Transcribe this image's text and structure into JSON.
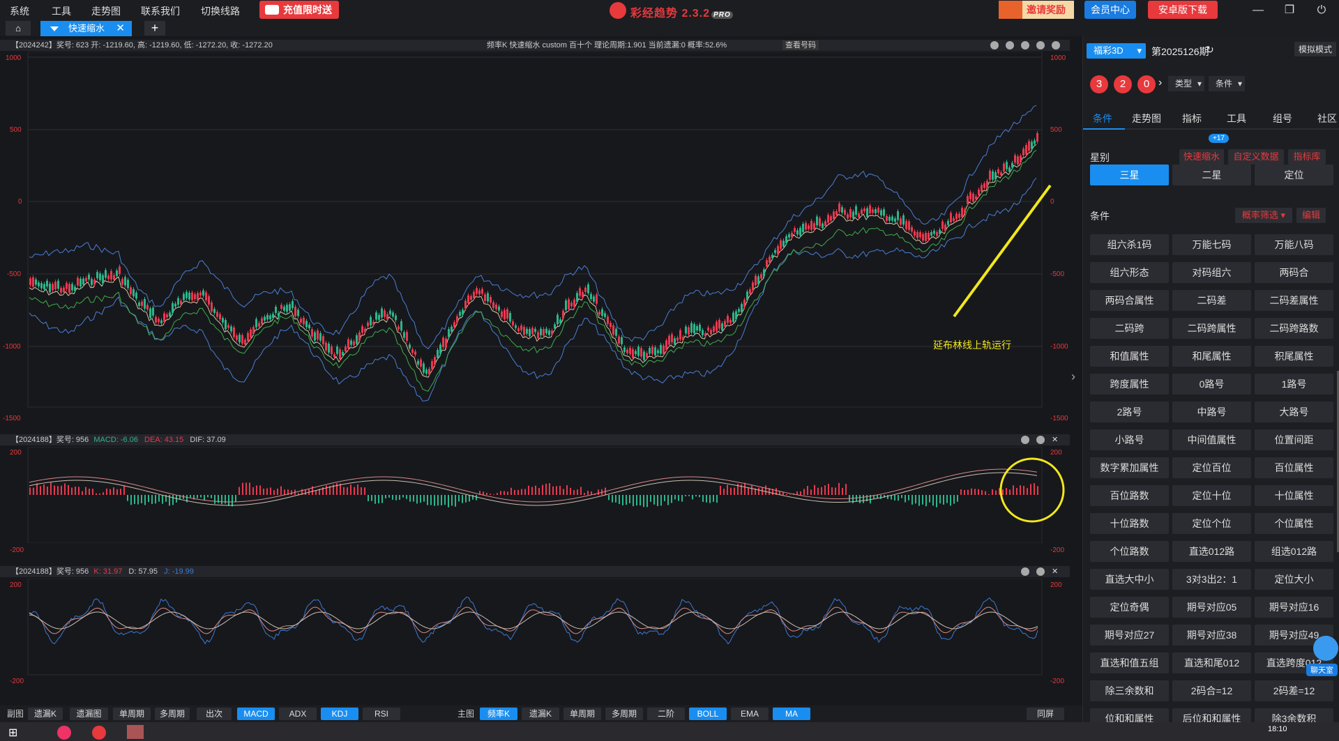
{
  "menu": [
    "系统",
    "工具",
    "走势图",
    "联系我们",
    "切换线路"
  ],
  "promo_label": "充值限时送",
  "app_title": "彩经趋势 2.3.2",
  "app_badge": "PRO",
  "invite_label": "邀请奖励",
  "vip_label": "会员中心",
  "android_label": "安卓版下载",
  "tab_label": "快速缩水",
  "main_head_left": "【2024242】奖号: 623  开: -1219.60, 高: -1219.60, 低: -1272.20, 收: -1272.20",
  "main_head_mid": "频率K  快速缩水  custom  百十个  理论周期:1.901  当前遗漏:0  概率:52.6%",
  "main_head_btn": "查看号码",
  "main_axis": [
    "1000",
    "500",
    "0",
    "-500",
    "-1000",
    "-1500"
  ],
  "macd_head": "【2024188】奖号: 956",
  "macd_lbl": "MACD:",
  "macd_val": "-6.06",
  "dea_lbl": "DEA:",
  "dea_val": "43.15",
  "dif_lbl": "DIF:",
  "dif_val": "37.09",
  "macd_axis": [
    "200",
    "-200"
  ],
  "kdj_head": "【2024188】奖号: 956",
  "k_lbl": "K:",
  "k_val": "31.97",
  "d_lbl": "D:",
  "d_val": "57.95",
  "j_lbl": "J:",
  "j_val": "-19.99",
  "kdj_axis": [
    "200",
    "-200"
  ],
  "annotation": "延布林线上轨运行",
  "bottom": {
    "sub_label": "副图",
    "sub": [
      "遗漏K",
      "遗漏图",
      "单周期",
      "多周期",
      "出次",
      "MACD",
      "ADX",
      "KDJ",
      "RSI"
    ],
    "main_label": "主图",
    "main": [
      "频率K",
      "遗漏K",
      "单周期",
      "多周期",
      "二阶",
      "BOLL",
      "EMA",
      "MA"
    ],
    "sync": "同屏"
  },
  "side": {
    "lottery": "福彩3D",
    "period": "第2025126期",
    "mode": "模拟模式",
    "balls": [
      "3",
      "2",
      "0"
    ],
    "type_dd": "类型",
    "cond_dd": "条件",
    "tabs": [
      "条件",
      "走势图",
      "指标",
      "工具",
      "组号",
      "社区"
    ],
    "star_label": "星别",
    "quick_btn": "快速缩水",
    "quick_badge": "+17",
    "custom_btn": "自定义数据",
    "lib_btn": "指标库",
    "stars": [
      "三星",
      "二星",
      "定位"
    ],
    "cond_label": "条件",
    "prob_dd": "概率筛选",
    "edit_btn": "编辑",
    "conds": [
      "组六杀1码",
      "万能七码",
      "万能八码",
      "组六形态",
      "对码组六",
      "两码合",
      "两码合属性",
      "二码差",
      "二码差属性",
      "二码跨",
      "二码跨属性",
      "二码跨路数",
      "和值属性",
      "和尾属性",
      "积尾属性",
      "跨度属性",
      "0路号",
      "1路号",
      "2路号",
      "中路号",
      "大路号",
      "小路号",
      "中间值属性",
      "位置间距",
      "数字累加属性",
      "定位百位",
      "百位属性",
      "百位路数",
      "定位十位",
      "十位属性",
      "十位路数",
      "定位个位",
      "个位属性",
      "个位路数",
      "直选012路",
      "组选012路",
      "直选大中小",
      "3对3出2：1",
      "定位大小",
      "定位奇偶",
      "期号对应05",
      "期号对应16",
      "期号对应27",
      "期号对应38",
      "期号对应49",
      "直选和值五组",
      "直选和尾012",
      "直选跨度012",
      "除三余数和",
      "2码合=12",
      "2码差=12",
      "位和和属性",
      "后位和和属性",
      "除3余数积"
    ],
    "chat": "聊天室"
  },
  "time": "18:10",
  "colors": {
    "accent": "#1a8ef0",
    "red": "#e8393d",
    "up": "#e8394f",
    "down": "#2bb68a",
    "annot": "#f2e71c"
  }
}
